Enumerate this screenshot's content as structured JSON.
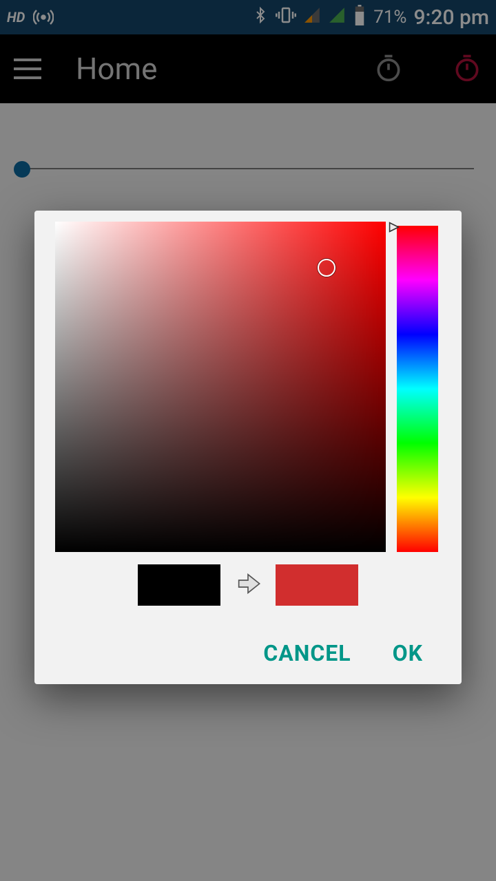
{
  "status": {
    "hd": "HD",
    "battery": "71%",
    "time": "9:20 pm"
  },
  "appbar": {
    "title": "Home"
  },
  "dialog": {
    "old_color": "#000000",
    "new_color": "#d12e2e",
    "cancel_label": "CANCEL",
    "ok_label": "OK"
  }
}
